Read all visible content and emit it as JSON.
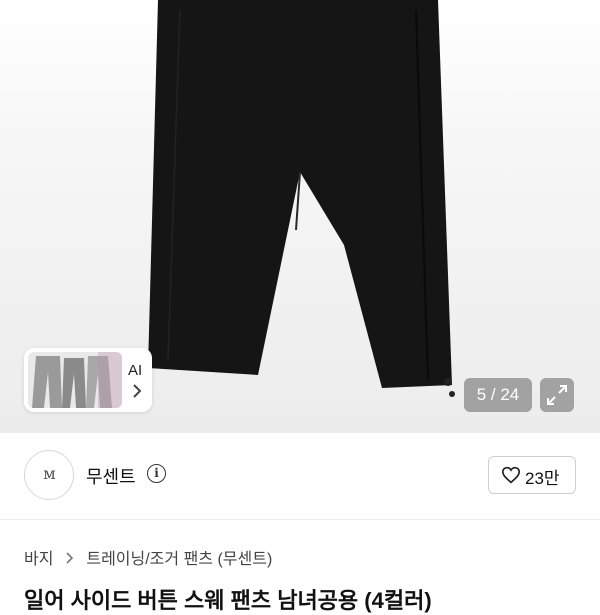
{
  "ai_card": {
    "label": "AI",
    "chevron": "chevron-right-icon"
  },
  "gallery": {
    "counter": "5 / 24",
    "expand_icon": "expand-icon"
  },
  "seller": {
    "logo_text": "ᴍ",
    "name": "무센트",
    "info_icon": "info-icon",
    "like_icon": "heart-outline-icon",
    "like_count": "23만"
  },
  "breadcrumb": {
    "items": [
      "바지",
      "트레이닝/조거 팬츠 (무센트)"
    ],
    "separator_icon": "chevron-right-icon"
  },
  "product": {
    "title": "일어 사이드 버튼 스웨 팬츠 남녀공용 (4컬러)"
  },
  "colors": {
    "pants": "#141414",
    "background": "#ececec",
    "overlay": "#646464"
  }
}
